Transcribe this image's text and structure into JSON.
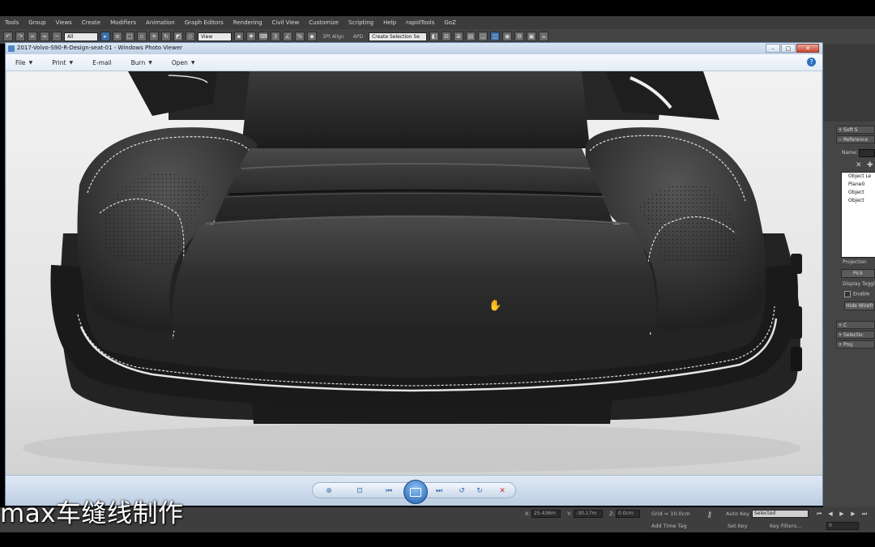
{
  "max": {
    "menubar": [
      "Tools",
      "Group",
      "Views",
      "Create",
      "Modifiers",
      "Animation",
      "Graph Editors",
      "Rendering",
      "Civil View",
      "Customize",
      "Scripting",
      "Help",
      "rapidTools",
      "GoZ"
    ],
    "toolbar": {
      "filter_select": "All",
      "view_select": "View",
      "align_label": "3Pt Align",
      "apd_label": "APD",
      "selection_set": "Create Selection Se"
    },
    "right_panel": {
      "rollouts": [
        "Soft S",
        "Reference",
        "C",
        "Selectio",
        "Proj"
      ],
      "name_label": "Name:",
      "list_items": [
        "Object Le",
        "Plane0",
        "Object",
        "Object"
      ],
      "projection_label": "Projection",
      "pick_button": "Pick",
      "display_toggle_label": "Display Toggl",
      "enable_label": "Enable",
      "hide_wireframe_button": "Hide Wirefr"
    },
    "status": {
      "x_label": "X:",
      "x_value": "25.436m",
      "y_label": "Y:",
      "y_value": "-30.17m",
      "z_label": "Z:",
      "z_value": "0.0cm",
      "grid": "Grid = 10.0cm",
      "auto_key": "Auto Key",
      "selected": "Selected",
      "set_key": "Set Key",
      "key_filters": "Key Filters...",
      "add_time_tag": "Add Time Tag",
      "frame": "0"
    }
  },
  "photo_viewer": {
    "title": "2017-Volvo-S90-R-Design-seat-01 - Windows Photo Viewer",
    "menus": [
      "File",
      "Print",
      "E-mail",
      "Burn",
      "Open"
    ],
    "help": "?"
  },
  "subtitle": "max车缝线制作",
  "colors": {
    "leather": "#2a2a2a",
    "stitch": "#e8e8e8",
    "viewer_chrome": "#cad8e8",
    "max_bg": "#444444"
  }
}
